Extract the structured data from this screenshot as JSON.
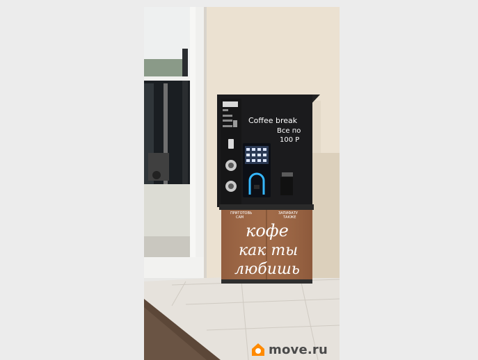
{
  "photo": {
    "alt": "",
    "machine": {
      "brand_sign": "Coffee break",
      "price_line1": "Все по",
      "price_line2": "100 Р",
      "label_left_line1": "ПРИГОТОВЬ",
      "label_left_line2": "САМ",
      "label_right_line1": "ЗАПИФАТУ",
      "label_right_line2": "ТАКЖЕ",
      "slogan_line1": "кофе",
      "slogan_line2": "как ты",
      "slogan_line3": "любишь"
    }
  },
  "watermark": {
    "text": "move.ru",
    "icon": "house-logo-icon",
    "color": "#ff8a00"
  }
}
